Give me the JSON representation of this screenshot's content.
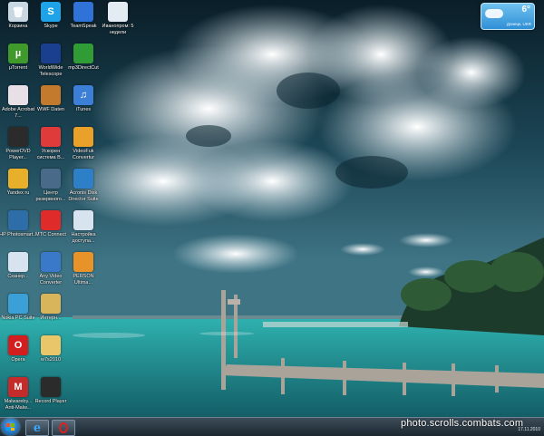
{
  "desktop": {
    "icons": [
      {
        "label": "Корзина",
        "glyph": "🗑",
        "color": "#c9d7e3"
      },
      {
        "label": "Skype",
        "glyph": "S",
        "color": "#1fa3e8"
      },
      {
        "label": "TeamSpeak",
        "glyph": "",
        "color": "#2f73d9"
      },
      {
        "label": "Иванопром: 5 недели",
        "glyph": "",
        "color": "#e4ecf3"
      },
      {
        "label": "µTorrent",
        "glyph": "µ",
        "color": "#3f9a2b"
      },
      {
        "label": "WorldWide Telescope",
        "glyph": "",
        "color": "#1b3f8f"
      },
      {
        "label": "mp3DirectCut",
        "glyph": "",
        "color": "#2f9c35"
      },
      {
        "label": "Adobe Acrobat 7...",
        "glyph": "",
        "color": "#e9dfe6"
      },
      {
        "label": "WWF Daten",
        "glyph": "",
        "color": "#c47a2c"
      },
      {
        "label": "iTunes",
        "glyph": "♫",
        "color": "#3c7fd6"
      },
      {
        "label": "PowerDVD Player...",
        "glyph": "",
        "color": "#2b2b2b"
      },
      {
        "label": "Ускорен система В...",
        "glyph": "",
        "color": "#e03b3b"
      },
      {
        "label": "VideoFuk Convertur",
        "glyph": "",
        "color": "#e9a12a"
      },
      {
        "label": "Yandex ru",
        "glyph": "",
        "color": "#e8b02a"
      },
      {
        "label": "Центр резервного...",
        "glyph": "",
        "color": "#4a6a8a"
      },
      {
        "label": "Acronis Disk Director Suite",
        "glyph": "",
        "color": "#2d7fc8"
      },
      {
        "label": "HP Photosmart...",
        "glyph": "",
        "color": "#2d6ea8"
      },
      {
        "label": "MTC Connect",
        "glyph": "",
        "color": "#e02b2b"
      },
      {
        "label": "Настройка доступа...",
        "glyph": "",
        "color": "#d7e3ee"
      },
      {
        "label": "Сканер...",
        "glyph": "",
        "color": "#d7e3ee"
      },
      {
        "label": "Any Video Converter",
        "glyph": "",
        "color": "#3a78c9"
      },
      {
        "label": "PERSON Ultima...",
        "glyph": "",
        "color": "#e8922a"
      },
      {
        "label": "Nokia PC Suite",
        "glyph": "",
        "color": "#3ba0d8"
      },
      {
        "label": "Интерн...",
        "glyph": "",
        "color": "#d8b45a"
      },
      {
        "label": "Opera",
        "glyph": "O",
        "color": "#d21e1e"
      },
      {
        "label": "w7s2010",
        "glyph": "",
        "color": "#e9c66a"
      },
      {
        "label": "Malwareby... Anti-Malw...",
        "glyph": "M",
        "color": "#c42b2b"
      },
      {
        "label": "Record Player",
        "glyph": "",
        "color": "#2b2b2b"
      }
    ]
  },
  "weather": {
    "temperature": "6°",
    "city": "Донецк, UKR"
  },
  "taskbar": {
    "start_label": "Start",
    "pinned": [
      "Internet Explorer",
      "Opera"
    ],
    "date": "17.11.2010"
  },
  "watermark": "photo.scrolls.combats.com",
  "colors": {
    "taskbar": "#1c2730",
    "accent": "#4fb0ff",
    "sea": "#1f8f8f"
  }
}
